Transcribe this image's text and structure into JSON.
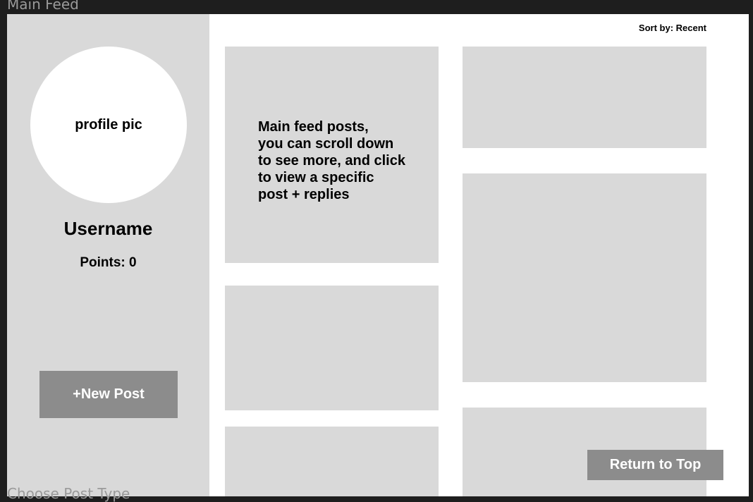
{
  "canvas": {
    "frame_label": "Main Feed",
    "next_frame_label": "Choose Post Type"
  },
  "sidebar": {
    "avatar_label": "profile pic",
    "username": "Username",
    "points": "Points: 0",
    "new_post_label": "+New Post"
  },
  "feed": {
    "sort_label": "Sort by: Recent",
    "posts": [
      {
        "text": "Main feed posts,\nyou can scroll down\nto see more, and click\nto view a specific\npost + replies"
      },
      {
        "text": ""
      },
      {
        "text": ""
      },
      {
        "text": ""
      },
      {
        "text": ""
      },
      {
        "text": ""
      }
    ],
    "return_top_label": "Return to Top"
  },
  "colors": {
    "background": "#1e1e1e",
    "panel": "#d9d9d9",
    "button": "#8c8c8c",
    "surface": "#ffffff"
  }
}
